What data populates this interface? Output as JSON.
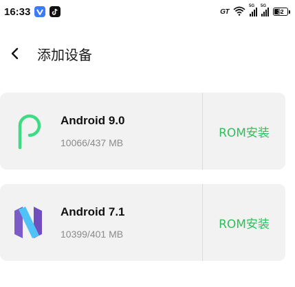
{
  "status_bar": {
    "time": "16:33",
    "network_label": "GT",
    "sim1_label": "5G",
    "sim2_label": "5G",
    "battery_level": "32",
    "badges": [
      "v-app-icon",
      "tiktok-icon"
    ]
  },
  "header": {
    "back_icon": "chevron-left-icon",
    "title": "添加设备"
  },
  "devices": [
    {
      "name": "Android 9.0",
      "detail": "10066/437 MB",
      "action": "ROM安装",
      "logo": "android-pie-logo"
    },
    {
      "name": "Android 7.1",
      "detail": "10399/401 MB",
      "action": "ROM安装",
      "logo": "android-nougat-logo"
    }
  ],
  "colors": {
    "accent_green": "#2fbf5a",
    "card_bg": "#f2f2f3",
    "pie_green": "#3ddc84",
    "nougat_purple": "#7b5bc7",
    "nougat_blue": "#4fc3f7"
  }
}
